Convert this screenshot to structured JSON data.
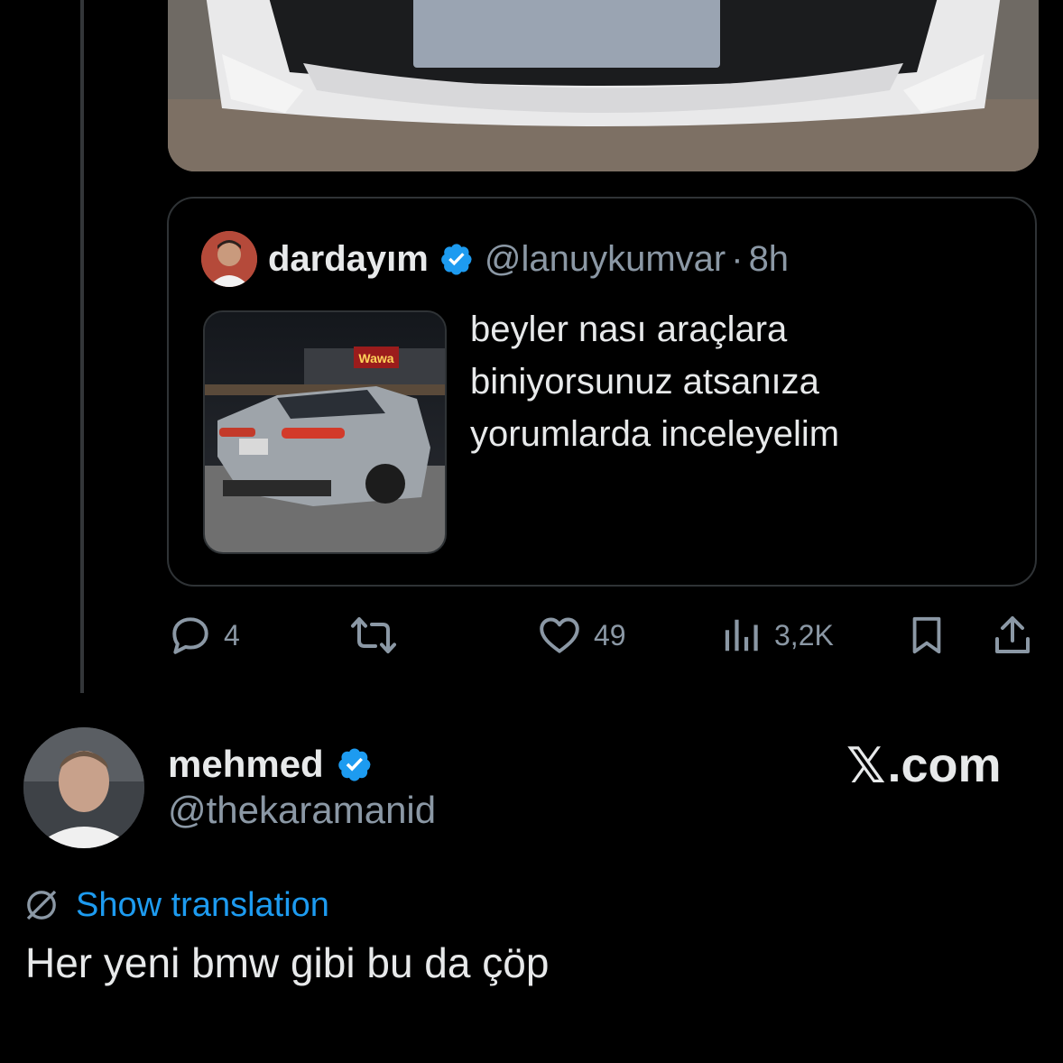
{
  "colors": {
    "background": "#000000",
    "text_primary": "#e7e9ea",
    "text_secondary": "#8b98a5",
    "accent_link": "#1d9bf0",
    "verified_badge": "#1d9bf0",
    "border": "#2f3336"
  },
  "quoted_tweet": {
    "author_name": "dardayım",
    "author_handle": "@lanuykumvar",
    "separator": "·",
    "time": "8h",
    "verified": true,
    "text_lines": [
      "beyler nası araçlara",
      "biniyorsunuz atsanıza",
      "yorumlarda inceleyelim"
    ],
    "thumbnail_icon": "car-photo",
    "storefront_sign": "Wawa"
  },
  "actions": {
    "reply": {
      "icon": "reply-icon",
      "count": "4"
    },
    "retweet": {
      "icon": "retweet-icon",
      "count": ""
    },
    "like": {
      "icon": "heart-icon",
      "count": "49"
    },
    "views": {
      "icon": "views-icon",
      "count": "3,2K"
    },
    "bookmark": {
      "icon": "bookmark-icon"
    },
    "share": {
      "icon": "share-icon"
    }
  },
  "reply_tweet": {
    "author_name": "mehmed",
    "author_handle": "@thekaramanid",
    "verified": true,
    "brand_x": "𝕏",
    "brand_domain": ".com",
    "show_translation": "Show translation",
    "text": "Her yeni bmw gibi bu da çöp"
  }
}
